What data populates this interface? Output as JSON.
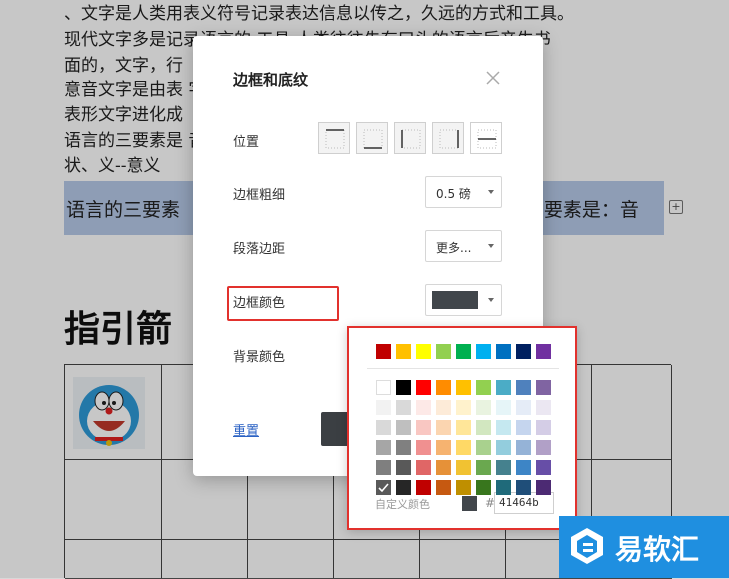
{
  "document": {
    "lines": [
      "、文字是人类用表义符号记录表达信息以传之，久远的方式和工具。",
      "现代文字多是记录语言的    工具    人类往往先有口头的语言后产生书",
      "面的，文字，行",
      "意音文字是由表                                           字，汉字是由",
      "表形文字进化成",
      "语言的三要素是                                           音、--字  符形",
      "状、义--意义"
    ],
    "highlight_left": "语言的三要素",
    "highlight_right": "E要素是：音",
    "heading": "指引箭"
  },
  "dialog": {
    "title": "边框和底纹",
    "position_label": "位置",
    "width_label": "边框粗细",
    "width_value": "0.5 磅",
    "spacing_label": "段落边距",
    "spacing_value": "更多...",
    "border_color_label": "边框颜色",
    "border_color_value": "#41464b",
    "bg_color_label": "背景颜色",
    "reset_label": "重置"
  },
  "palette": {
    "standard": [
      "#c00000",
      "#ffc000",
      "#ffff00",
      "#92d050",
      "#00b050",
      "#00b0f0",
      "#0070c0",
      "#002060",
      "#7030a0"
    ],
    "theme": [
      [
        "#ffffff",
        "#000000",
        "#ff0000",
        "#ff8c00",
        "#ffc000",
        "#92d050",
        "#4bacc6",
        "#4f81bd",
        "#8064a2"
      ],
      [
        "#f2f2f2",
        "#d9d9d9",
        "#fde9e7",
        "#fdebd8",
        "#fff2cc",
        "#e9f3e0",
        "#e6f5f8",
        "#e5ecf7",
        "#ebe7f2"
      ],
      [
        "#d9d9d9",
        "#bfbfbf",
        "#f9c7c2",
        "#fbd5b0",
        "#ffe699",
        "#d2e7c0",
        "#c5e8f0",
        "#c5d5ee",
        "#d4cde6"
      ],
      [
        "#a6a6a6",
        "#808080",
        "#f09090",
        "#f6b370",
        "#ffd966",
        "#a9d18e",
        "#93cddd",
        "#95b3d7",
        "#b1a0c7"
      ],
      [
        "#7f7f7f",
        "#595959",
        "#e06666",
        "#e69138",
        "#f1c232",
        "#6aa84f",
        "#45818e",
        "#3d85c6",
        "#674ea7"
      ],
      [
        "#595959",
        "#262626",
        "#c00000",
        "#c65911",
        "#bf8f00",
        "#38761d",
        "#1f6a7a",
        "#1f4e79",
        "#4c2a73"
      ]
    ],
    "selected": "#595959",
    "custom_label": "自定义颜色",
    "hash": "#",
    "hex_value": "41464b"
  },
  "watermark": {
    "text": "易软汇"
  }
}
